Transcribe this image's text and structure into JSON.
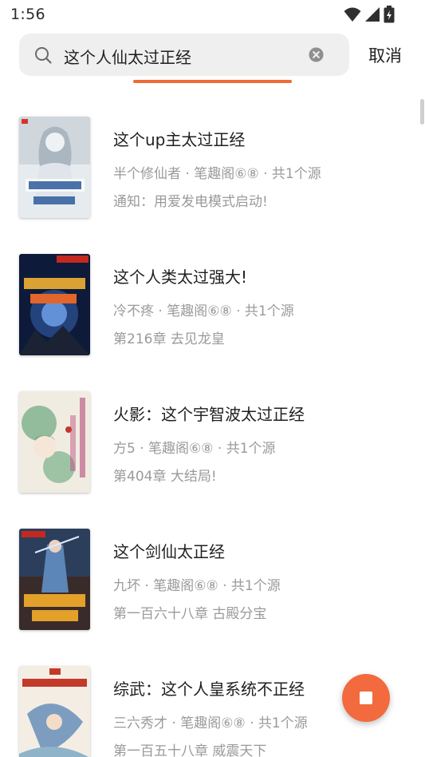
{
  "status_bar": {
    "time": "1:56",
    "icons": [
      "wifi-icon",
      "cell-signal-icon",
      "battery-charging-icon"
    ]
  },
  "search": {
    "query": "这个人仙太过正经",
    "cancel_label": "取消"
  },
  "results": [
    {
      "title": "这个up主太过正经",
      "meta": "半个修仙者 · 笔趣阁⑥⑧ · 共1个源",
      "latest": "通知：用爱发电模式启动!"
    },
    {
      "title": "这个人类太过强大!",
      "meta": "冷不疼 · 笔趣阁⑥⑧ · 共1个源",
      "latest": "第216章 去见龙皇"
    },
    {
      "title": "火影：这个宇智波太过正经",
      "meta": "方5 · 笔趣阁⑥⑧ · 共1个源",
      "latest": "第404章 大结局!"
    },
    {
      "title": "这个剑仙太正经",
      "meta": "九坏 · 笔趣阁⑥⑧ · 共1个源",
      "latest": "第一百六十八章 古殿分宝"
    },
    {
      "title": "综武：这个人皇系统不正经",
      "meta": "三六秀才 · 笔趣阁⑥⑧ · 共1个源",
      "latest": "第一百五十八章 威震天下"
    }
  ],
  "colors": {
    "accent": "#ef6a35",
    "fab": "#f26a3d",
    "secondary_text": "#9a9a9a"
  }
}
